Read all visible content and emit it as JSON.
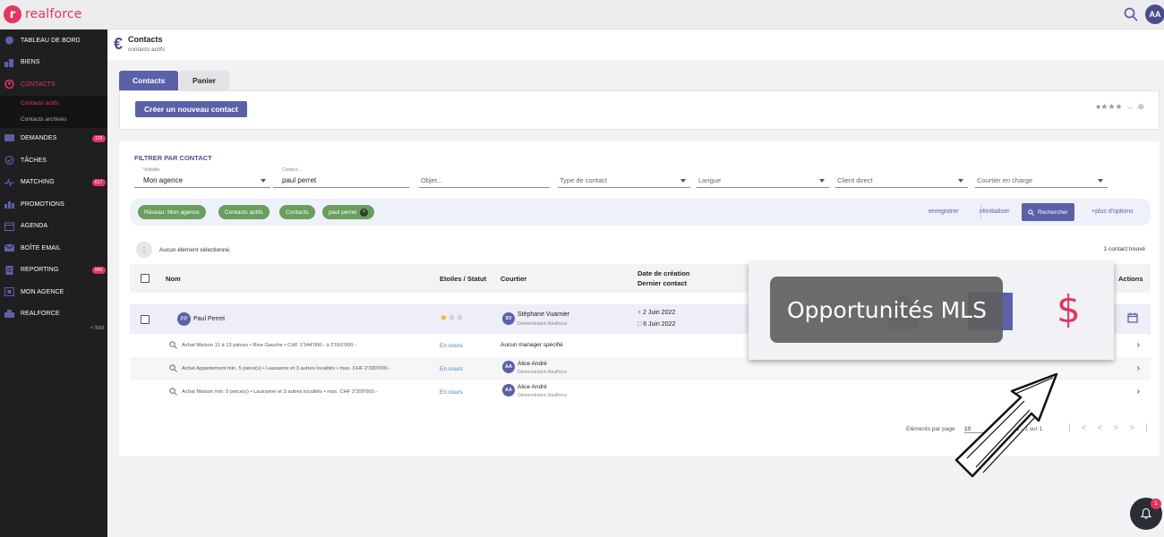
{
  "app": {
    "logo_mark": "r",
    "logo_text": "realforce",
    "user_initials": "AA"
  },
  "sidebar": {
    "items": [
      {
        "label": "TABLEAU DE BORD",
        "badge": ""
      },
      {
        "label": "BIENS",
        "badge": ""
      },
      {
        "label": "CONTACTS",
        "badge": ""
      },
      {
        "label": "DEMANDES",
        "badge": "129"
      },
      {
        "label": "TÂCHES",
        "badge": ""
      },
      {
        "label": "MATCHING",
        "badge": "617"
      },
      {
        "label": "PROMOTIONS",
        "badge": ""
      },
      {
        "label": "AGENDA",
        "badge": ""
      },
      {
        "label": "BOÎTE EMAIL",
        "badge": ""
      },
      {
        "label": "REPORTING",
        "badge": "845"
      },
      {
        "label": "MON AGENCE",
        "badge": ""
      },
      {
        "label": "REALFORCE",
        "badge": ""
      }
    ],
    "sub_items": [
      "Contacts actifs",
      "Contacts archivés"
    ],
    "fold_label": "< fold"
  },
  "header": {
    "title": "Contacts",
    "subtitle": "contacts actifs"
  },
  "tabs": [
    "Contacts",
    "Panier"
  ],
  "create_button": "Créer un nouveau contact",
  "filter": {
    "title": "FILTRER PAR CONTACT",
    "fields": [
      {
        "label": "Visibilité",
        "value": "Mon agence",
        "placeholder": ""
      },
      {
        "label": "Contact...",
        "value": "paul perret",
        "placeholder": ""
      },
      {
        "label": "",
        "value": "",
        "placeholder": "Objet..."
      },
      {
        "label": "",
        "value": "",
        "placeholder": "Type de contact"
      },
      {
        "label": "",
        "value": "",
        "placeholder": "Langue"
      },
      {
        "label": "",
        "value": "",
        "placeholder": "Client direct"
      },
      {
        "label": "",
        "value": "",
        "placeholder": "Courtier en charge"
      }
    ],
    "chips": [
      "Réseau: Mon agence",
      "Contacts actifs",
      "Contacts",
      "paul perret"
    ],
    "links": {
      "save": "enregistrer",
      "reset": "réinitialiser",
      "more": "+plus d'options"
    },
    "search_button": "Rechercher"
  },
  "selection_text": "Aucun élément sélectionné.",
  "found_text": "1 contact trouvé",
  "table": {
    "headers": {
      "name": "Nom",
      "stars_status": "Etoiles / Statut",
      "broker": "Courtier",
      "created": "Date de création",
      "last_contact": "Dernier contact",
      "actions": "Actions"
    },
    "contact": {
      "initials": "PP",
      "name": "Paul Perret",
      "stars": 1,
      "stars_max": 3,
      "broker_initials": "SV",
      "broker_name": "Stéphane Vuarnier",
      "broker_agency": "Démonstration Realforce",
      "created": "2 Juin 2022",
      "last_contact": "6 Juin 2022"
    },
    "requests": [
      {
        "desc": "Achat Maison 11 à 13 pièces • Rive Gauche • CHF 1'344'000.- à 2'016'000.-",
        "status": "En cours",
        "broker_initials": "",
        "broker_name": "Aucun manager spécifié",
        "broker_agency": ""
      },
      {
        "desc": "Achat Appartement min. 5 pièce(s) • Lausanne et 3 autres localités • max. CHF 2'300'000.-",
        "status": "En cours",
        "broker_initials": "AA",
        "broker_name": "Alice André",
        "broker_agency": "Démonstration Realforce"
      },
      {
        "desc": "Achat Maison min. 5 pièce(s) • Lausanne et 3 autres localités • max. CHF 2'300'000.-",
        "status": "En cours",
        "broker_initials": "AA",
        "broker_name": "Alice André",
        "broker_agency": "Démonstration Realforce"
      }
    ]
  },
  "pagination": {
    "label": "Eléments par page",
    "value": "10",
    "range": "1 - 1 sur 1"
  },
  "mls_tooltip": {
    "text": "Opportunités MLS",
    "symbol": "$"
  },
  "notifications": {
    "count": "1"
  }
}
